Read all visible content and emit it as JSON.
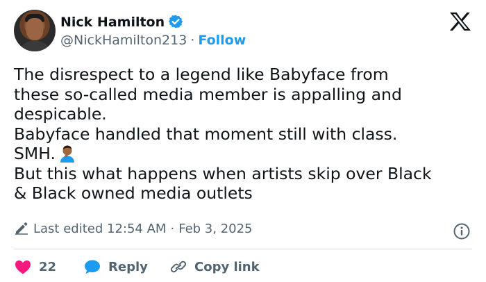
{
  "author": {
    "name": "Nick Hamilton",
    "handle": "@NickHamilton213",
    "separator": "·",
    "follow_label": "Follow"
  },
  "tweet": {
    "lines": [
      "The disrespect to a legend like Babyface  from",
      "these so-called media member is appalling and",
      "despicable.",
      "Babyface handled that moment still with class.",
      "SMH.",
      "But this what happens when artists skip over Black",
      "& Black owned media outlets"
    ],
    "emoji_icon": "person-facepalming-emoji"
  },
  "meta": {
    "edited_label": "Last edited",
    "time": "12:54 AM",
    "separator": "·",
    "date": "Feb 3, 2025"
  },
  "actions": {
    "like_count": "22",
    "reply_label": "Reply",
    "copy_link_label": "Copy link"
  },
  "colors": {
    "accent": "#1d9bf0",
    "like": "#f91880",
    "text": "#0f1419",
    "secondary": "#536471",
    "divider": "#cfd9de"
  },
  "icons": [
    "verified-badge-icon",
    "x-logo-icon",
    "pencil-icon",
    "info-icon",
    "heart-icon",
    "reply-bubble-icon",
    "link-icon"
  ]
}
